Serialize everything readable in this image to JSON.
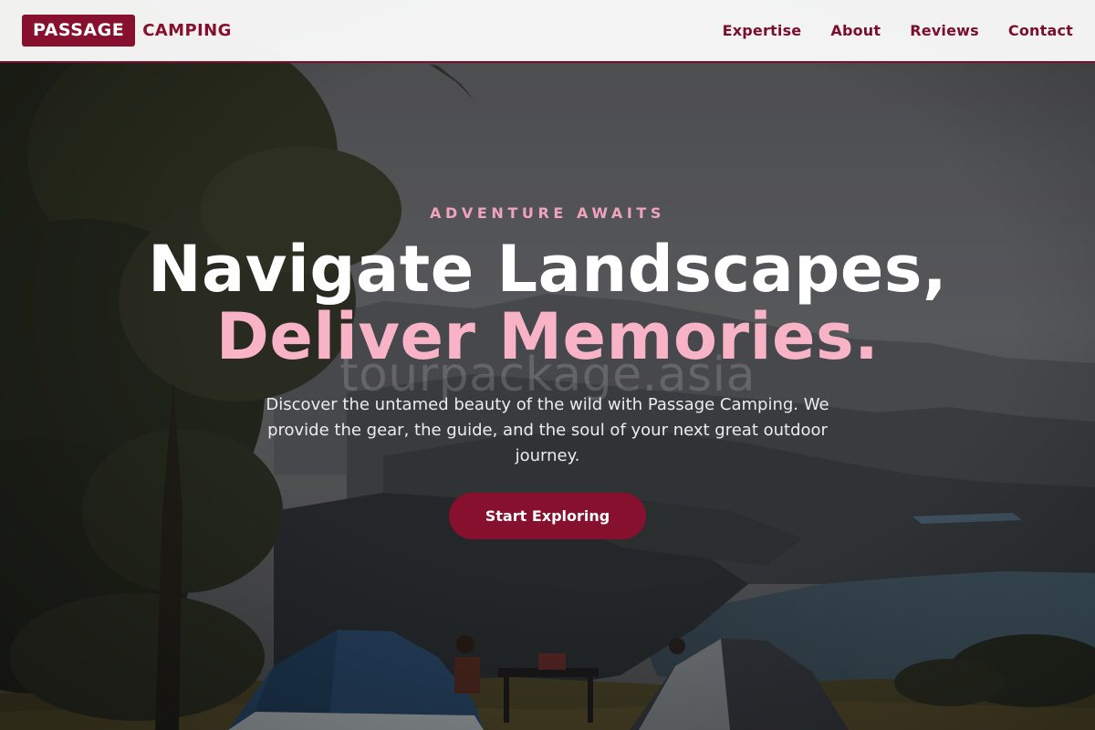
{
  "brand": {
    "box_text": "PASSAGE",
    "word_text": "CAMPING"
  },
  "nav": {
    "items": [
      {
        "label": "Expertise"
      },
      {
        "label": "About"
      },
      {
        "label": "Reviews"
      },
      {
        "label": "Contact"
      }
    ]
  },
  "hero": {
    "eyebrow": "ADVENTURE AWAITS",
    "headline_line1": "Navigate Landscapes,",
    "headline_line2": "Deliver Memories.",
    "watermark": "tourpackage.asia",
    "description": "Discover the untamed beauty of the wild with Passage Camping. We provide the gear, the guide, and the soul of your next great outdoor journey.",
    "cta_label": "Start Exploring"
  },
  "colors": {
    "accent": "#86102d",
    "highlight_pink": "#f8b3c7",
    "eyebrow_pink": "#f0a4bb"
  }
}
